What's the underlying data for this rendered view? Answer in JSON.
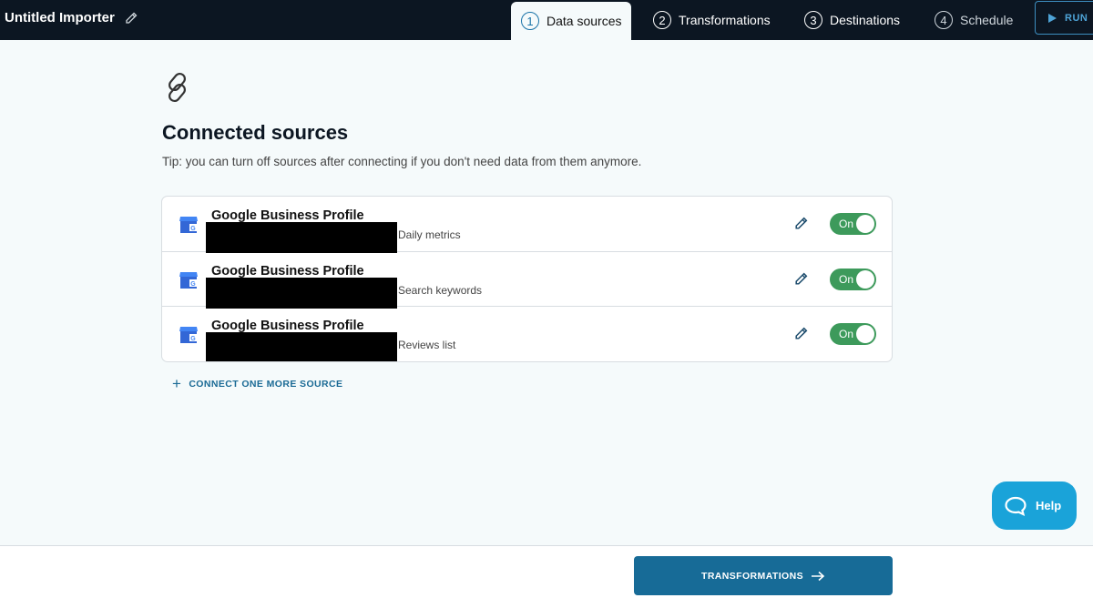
{
  "header": {
    "title": "Untitled Importer",
    "tabs": [
      {
        "number": "1",
        "label": "Data sources",
        "state": "active"
      },
      {
        "number": "2",
        "label": "Transformations",
        "state": "default"
      },
      {
        "number": "3",
        "label": "Destinations",
        "state": "default"
      },
      {
        "number": "4",
        "label": "Schedule",
        "state": "muted"
      }
    ],
    "run_label": "RUN"
  },
  "main": {
    "icon": "chain-link-icon",
    "title": "Connected sources",
    "tip": "Tip: you can turn off sources after connecting if you don't need data from them anymore.",
    "sources": [
      {
        "name": "Google Business Profile",
        "type": "Daily metrics",
        "toggle_label": "On",
        "enabled": true,
        "icon": "google-business-profile-icon"
      },
      {
        "name": "Google Business Profile",
        "type": "Search keywords",
        "toggle_label": "On",
        "enabled": true,
        "icon": "google-business-profile-icon"
      },
      {
        "name": "Google Business Profile",
        "type": "Reviews list",
        "toggle_label": "On",
        "enabled": true,
        "icon": "google-business-profile-icon"
      }
    ],
    "connect_more_label": "CONNECT ONE MORE SOURCE"
  },
  "help": {
    "label": "Help"
  },
  "footer": {
    "next_label": "TRANSFORMATIONS"
  },
  "colors": {
    "topbar": "#0c1622",
    "accent": "#176b97",
    "toggle_on": "#3d9a5b",
    "help": "#1aa3d9"
  }
}
